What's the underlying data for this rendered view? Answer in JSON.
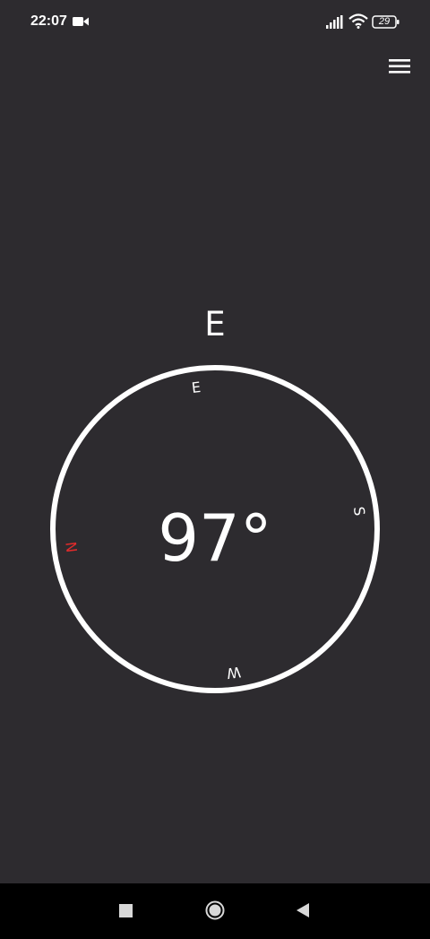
{
  "status_bar": {
    "time": "22:07",
    "battery": "29",
    "icons": [
      "video-camera-icon",
      "signal-icon",
      "wifi-icon",
      "battery-icon"
    ]
  },
  "menu": {
    "icon": "hamburger-menu-icon"
  },
  "compass": {
    "heading_direction": "E",
    "heading_degrees": "97°",
    "dial": {
      "north_label": "N",
      "east_label": "E",
      "south_label": "S",
      "west_label": "W"
    },
    "colors": {
      "north": "#e02b2b",
      "ring": "#ffffff",
      "background": "#2d2b2f"
    }
  },
  "nav_bar": {
    "icons": [
      "recent-apps-icon",
      "home-icon",
      "back-icon"
    ]
  }
}
